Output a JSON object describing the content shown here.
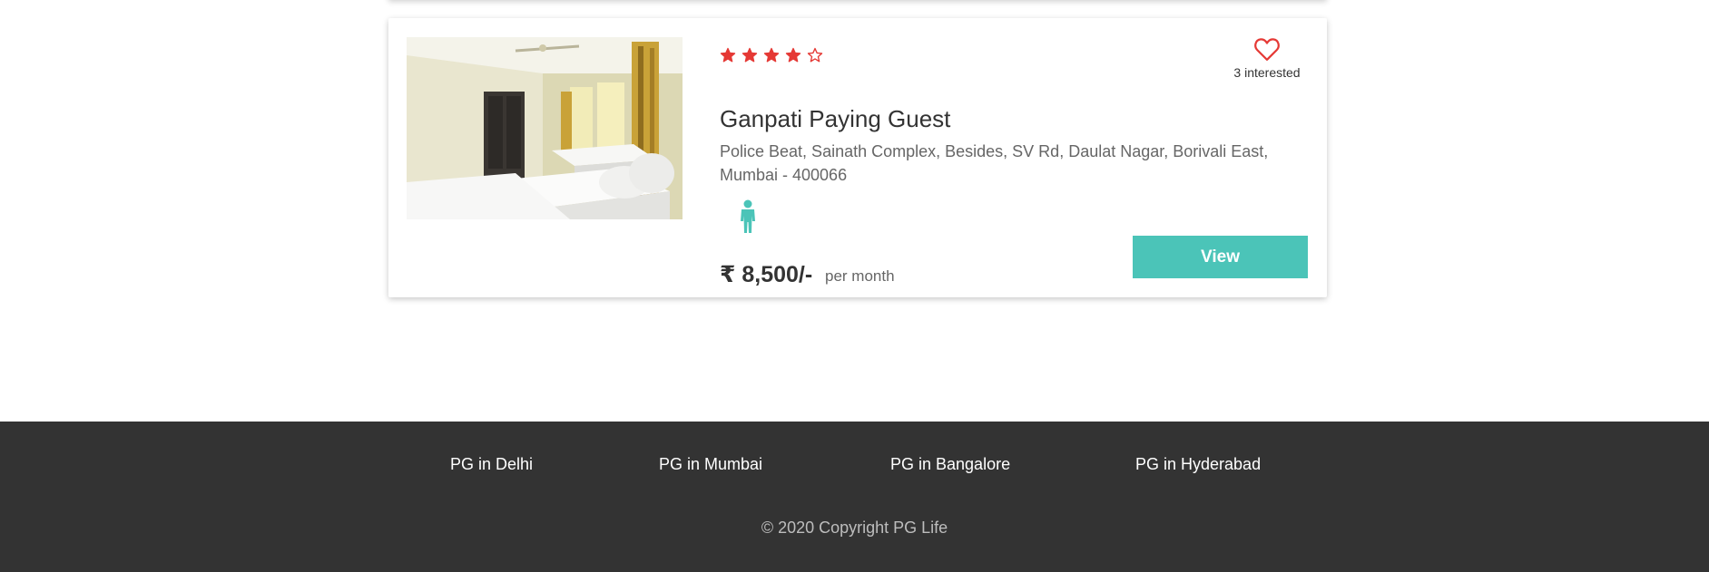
{
  "listing": {
    "rating": 4,
    "max_rating": 5,
    "name": "Ganpati Paying Guest",
    "address": "Police Beat, Sainath Complex, Besides, SV Rd, Daulat Nagar, Borivali East, Mumbai - 400066",
    "gender_icon": "male-icon",
    "interested_text": "3 interested",
    "favorite_icon": "heart-outline-icon",
    "price": "₹ 8,500/-",
    "price_unit": "per month",
    "view_label": "View",
    "star_color": "#e53935",
    "accent_color": "#4bc4b8"
  },
  "footer": {
    "links": [
      "PG in Delhi",
      "PG in Mumbai",
      "PG in Bangalore",
      "PG in Hyderabad"
    ],
    "copyright": "© 2020 Copyright PG Life",
    "background": "#333333"
  }
}
